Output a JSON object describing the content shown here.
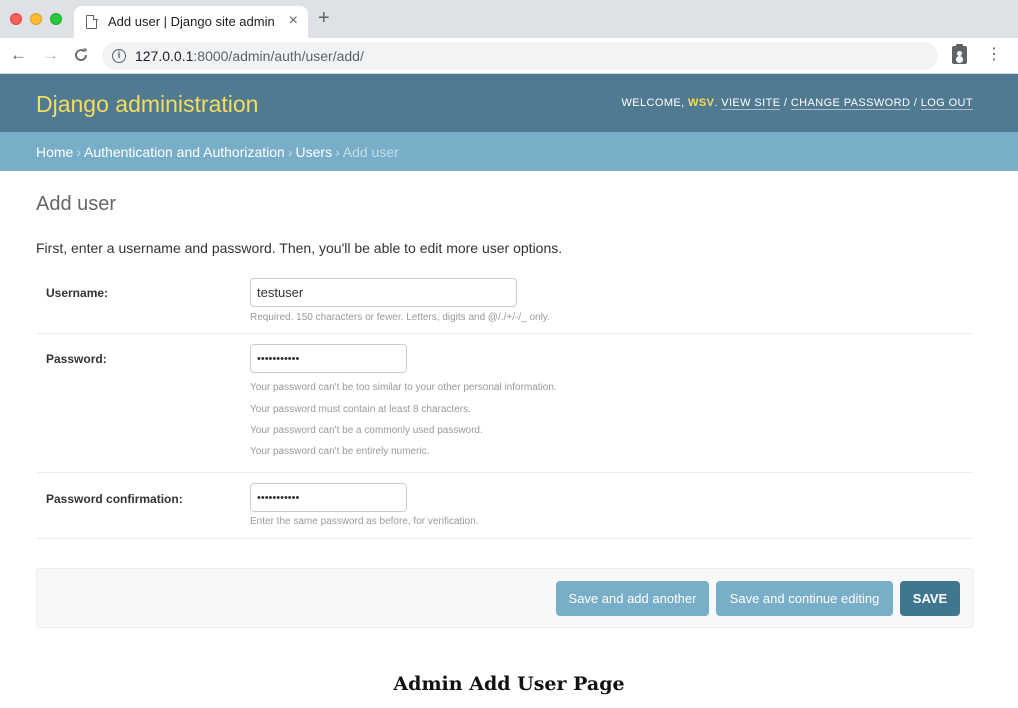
{
  "browser": {
    "tab_title": "Add user | Django site admin",
    "tab_close": "×",
    "new_tab": "+",
    "url_host": "127.0.0.1",
    "url_rest": ":8000/admin/auth/user/add/",
    "back": "←",
    "forward": "→",
    "reload": "C",
    "menu": "⋮"
  },
  "header": {
    "branding": "Django administration",
    "welcome": "WELCOME, ",
    "username": "WSV",
    "view_site": "VIEW SITE",
    "change_password": "CHANGE PASSWORD",
    "log_out": "LOG OUT"
  },
  "breadcrumbs": {
    "home": "Home",
    "app": "Authentication and Authorization",
    "model": "Users",
    "current": "Add user",
    "separator": "›"
  },
  "main": {
    "title": "Add user",
    "intro": "First, enter a username and password. Then, you'll be able to edit more user options."
  },
  "form": {
    "username": {
      "label": "Username:",
      "value": "testuser",
      "help": "Required. 150 characters or fewer. Letters, digits and @/./+/-/_ only."
    },
    "password": {
      "label": "Password:",
      "value": "•••••••••••",
      "help": [
        "Your password can't be too similar to your other personal information.",
        "Your password must contain at least 8 characters.",
        "Your password can't be a commonly used password.",
        "Your password can't be entirely numeric."
      ]
    },
    "password_confirmation": {
      "label": "Password confirmation:",
      "value": "•••••••••••",
      "help": "Enter the same password as before, for verification."
    }
  },
  "actions": {
    "save_add_another": "Save and add another",
    "save_continue": "Save and continue editing",
    "save": "SAVE"
  },
  "caption": "Admin Add User Page",
  "colors": {
    "header_bg": "#4f7a91",
    "breadcrumb_bg": "#79aec8",
    "branding": "#f5dd5d",
    "save_button": "#417690"
  }
}
